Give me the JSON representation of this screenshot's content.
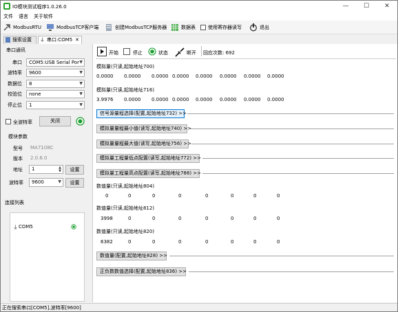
{
  "window": {
    "title": "IO模块测试程序1.0.26.0"
  },
  "menu": [
    "文件",
    "语言",
    "关于软件"
  ],
  "toolbar": {
    "modbus_rtu": "ModbusRTU",
    "modbus_tcp_client": "ModbusTCP客户端",
    "create_tcp_server": "创建ModbusTCP服务器",
    "data_table": "数据表",
    "use_register_rw": "使用寄存器读写",
    "exit": "退出"
  },
  "tabs": [
    "搜索设置",
    "串口:COM5"
  ],
  "serial": {
    "group_title": "串口通讯",
    "port_label": "串口",
    "port_value": "COM5:USB Serial Por",
    "baud_label": "波特率",
    "baud_value": "9600",
    "databits_label": "数据位",
    "databits_value": "8",
    "parity_label": "校验位",
    "parity_value": "none",
    "stopbits_label": "停止位",
    "stopbits_value": "1",
    "full_baud_label": "全波特率",
    "close_btn": "关闭"
  },
  "module": {
    "group_title": "模块参数",
    "model_label": "型号",
    "model_value": "MA7108C",
    "version_label": "版本",
    "version_value": "2.0.6.0",
    "address_label": "地址",
    "address_value": "1",
    "baud_label": "波特率",
    "baud_value": "9600",
    "set_btn": "设置"
  },
  "conn": {
    "title": "连接列表",
    "item": "COM5"
  },
  "controls": {
    "start": "开始",
    "stop": "停止",
    "state": "状态",
    "disconnect": "断开",
    "reply_count": "回应次数: 692"
  },
  "analog1": {
    "label": "模拟量(只读,起始地址700)",
    "values": [
      "0.0000",
      "0.0000",
      "0.0000",
      "0.0000",
      "0.0000",
      "0.0000",
      "0.0000",
      "0.0000"
    ]
  },
  "analog2": {
    "label": "模拟量(只读,起始地址716)",
    "values": [
      "3.9976",
      "0.0000",
      "0.0000",
      "0.0000",
      "0.0000",
      "0.0000",
      "0.0000",
      "0.0000"
    ]
  },
  "sections": [
    "信号源量程选择(配置,起始地址732) >>",
    "模拟量量程最小值(读写,起始地址740) >>",
    "模拟量量程最大值(读写,起始地址756) >>",
    "模拟量工程量低点配置(读写,起始地址772) >>",
    "模拟量工程量高点配置(读写,起始地址788) >>"
  ],
  "num1": {
    "label": "数值量(只读,起始地址804)",
    "values": [
      "0",
      "0",
      "0",
      "0",
      "0",
      "0",
      "0",
      "0"
    ]
  },
  "num2": {
    "label": "数值量(只读,起始地址812)",
    "values": [
      "3998",
      "0",
      "0",
      "0",
      "0",
      "0",
      "0",
      "0"
    ]
  },
  "num3": {
    "label": "数值量(只读,起始地址820)",
    "values": [
      "6382",
      "0",
      "0",
      "0",
      "0",
      "0",
      "0",
      "0"
    ]
  },
  "sections2": [
    "数值量(配置,起始地址828) >>",
    "正负数数值选择(配置,起始地址836) >>"
  ],
  "statusbar": "正在搜索串口[COM5],波特率[9600]",
  "colors": {
    "accent": "#0078d7",
    "green": "#1a9e2f"
  }
}
